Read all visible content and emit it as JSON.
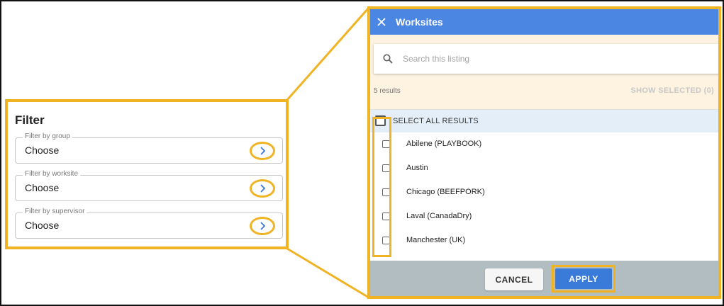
{
  "filter": {
    "title": "Filter",
    "fields": [
      {
        "label": "Filter by group",
        "value": "Choose"
      },
      {
        "label": "Filter by worksite",
        "value": "Choose"
      },
      {
        "label": "Filter by supervisor",
        "value": "Choose"
      }
    ]
  },
  "dialog": {
    "title": "Worksites",
    "search_placeholder": "Search this listing",
    "results_count": "5 results",
    "show_selected": "SHOW SELECTED (0)",
    "select_all": "SELECT ALL RESULTS",
    "items": [
      {
        "label": "Abilene (PLAYBOOK)"
      },
      {
        "label": "Austin"
      },
      {
        "label": "Chicago (BEEFPORK)"
      },
      {
        "label": "Laval (CanadaDry)"
      },
      {
        "label": "Manchester (UK)"
      }
    ],
    "cancel_label": "CANCEL",
    "apply_label": "APPLY"
  },
  "colors": {
    "highlight": "#f0b323",
    "header_blue": "#4a86e2",
    "apply_blue": "#3a7ad8",
    "footer_gray": "#b2bdc2",
    "search_bg": "#fdf3e0",
    "select_all_bg": "#e3eef9"
  },
  "icons": {
    "close": "close-icon",
    "search": "search-icon",
    "chevron": "chevron-right-icon"
  }
}
